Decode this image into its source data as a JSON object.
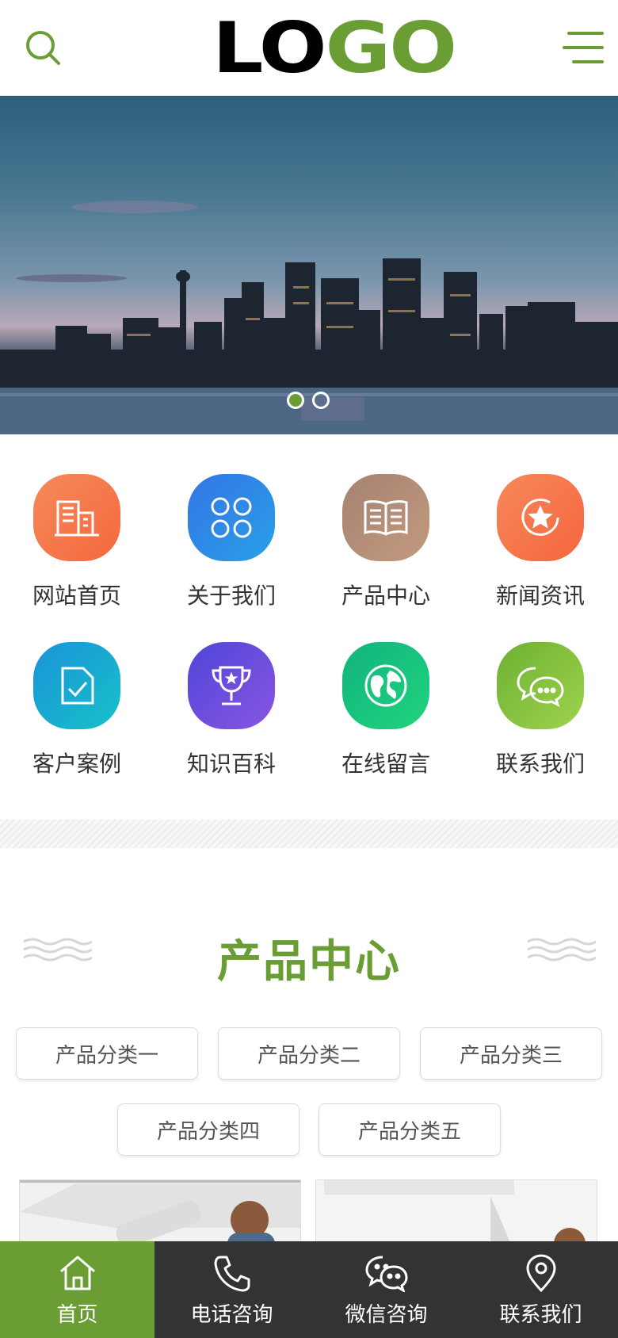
{
  "header": {
    "logo_part1": "LO",
    "logo_part2": "GO",
    "search_icon": "search-icon",
    "menu_icon": "menu-icon"
  },
  "banner": {
    "slides": 2,
    "active_slide": 1
  },
  "nav": {
    "items": [
      {
        "label": "网站首页",
        "icon": "building-icon",
        "color": "#f5784f"
      },
      {
        "label": "关于我们",
        "icon": "clover-icon",
        "color": "#2f86e8"
      },
      {
        "label": "产品中心",
        "icon": "book-icon",
        "color": "#b58c72"
      },
      {
        "label": "新闻资讯",
        "icon": "star-icon",
        "color": "#f5744c"
      },
      {
        "label": "客户案例",
        "icon": "document-check-icon",
        "color": "#1aa8d6"
      },
      {
        "label": "知识百科",
        "icon": "trophy-icon",
        "color": "#6f4fdd"
      },
      {
        "label": "在线留言",
        "icon": "globe-icon",
        "color": "#1fc27a"
      },
      {
        "label": "联系我们",
        "icon": "chat-icon",
        "color": "#7fbf3b"
      }
    ]
  },
  "products": {
    "title": "产品中心",
    "categories": [
      "产品分类一",
      "产品分类二",
      "产品分类三",
      "产品分类四",
      "产品分类五"
    ]
  },
  "bottombar": {
    "tabs": [
      {
        "label": "首页",
        "icon": "home-icon"
      },
      {
        "label": "电话咨询",
        "icon": "phone-icon"
      },
      {
        "label": "微信咨询",
        "icon": "wechat-icon"
      },
      {
        "label": "联系我们",
        "icon": "location-icon"
      }
    ]
  },
  "colors": {
    "accent": "#6a9e34",
    "dark_bar": "#333333"
  }
}
